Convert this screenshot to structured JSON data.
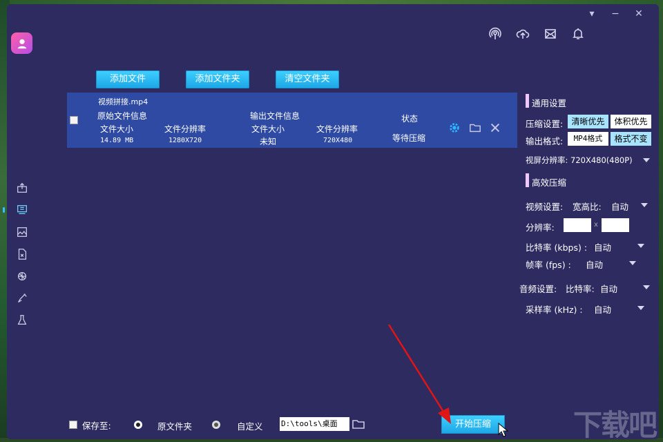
{
  "window_controls": {
    "dropdown_label": "▾",
    "minimize_label": "−",
    "close_label": "✕"
  },
  "toolbar": {
    "add_file": "添加文件",
    "add_folder": "添加文件夹",
    "clear_folder": "清空文件夹"
  },
  "file": {
    "name": "视频拼接.mp4",
    "original_header": "原始文件信息",
    "output_header": "输出文件信息",
    "status_header": "状态",
    "col_size": "文件大小",
    "col_resolution": "文件分辨率",
    "orig_size": "14.89 MB",
    "orig_resolution": "1280X720",
    "out_size": "未知",
    "out_resolution": "720X480",
    "status": "等待压缩"
  },
  "settings": {
    "general_title": "通用设置",
    "compress_label": "压缩设置:",
    "compress_opt1": "清晰优先",
    "compress_opt2": "体积优先",
    "output_label": "输出格式:",
    "output_opt1": "MP4格式",
    "output_opt2": "格式不变",
    "video_res_label": "视屏分辨率: 720X480(480P)",
    "efficient_title": "高效压缩",
    "video_setting_label": "视频设置:",
    "aspect_label": "宽高比:",
    "aspect_value": "自动",
    "resolution_label": "分辨率:",
    "resolution_sep": "x",
    "bitrate_label": "比特率 (kbps) :",
    "bitrate_value": "自动",
    "framerate_label": "帧率 (fps) :",
    "framerate_value": "自动",
    "audio_label": "音频设置:",
    "audio_bitrate_label": "比特率:",
    "audio_bitrate_value": "自动",
    "samplerate_label": "采样率 (kHz) :",
    "samplerate_value": "自动"
  },
  "bottom": {
    "save_to": "保存至:",
    "original_folder": "原文件夹",
    "custom": "自定义",
    "path": "D:\\tools\\桌面",
    "start": "开始压缩"
  },
  "watermark": "下载吧",
  "colors": {
    "background": "#2d2b60",
    "accent": "#1ba6e6",
    "row": "#2e4aa2",
    "arrow": "#e01515"
  }
}
